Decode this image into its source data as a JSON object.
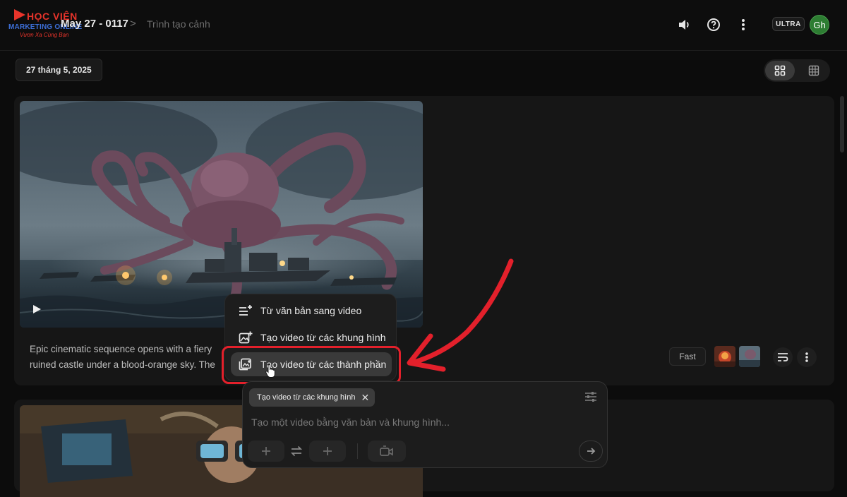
{
  "logo": {
    "line1": "HỌC VIỆN",
    "line2": "MARKETING ONLINE",
    "line3": "Vươn Xa Cùng Bạn"
  },
  "header": {
    "project_title": "May 27 - 0117",
    "separator": ">",
    "page_title": "Trình tạo cảnh",
    "plan_badge": "ULTRA",
    "avatar_initials": "Gh"
  },
  "toolbar": {
    "date_chip": "27 tháng 5, 2025"
  },
  "scene": {
    "prompt_line1": "Epic cinematic sequence opens with a fiery",
    "prompt_line2": "ruined castle under a blood-orange sky. The",
    "model_chip": "Fast"
  },
  "menu": {
    "items": [
      {
        "label": "Từ văn bản sang video",
        "icon": "text-lines-plus-icon"
      },
      {
        "label": "Tạo video từ các khung hình",
        "icon": "image-frames-icon"
      },
      {
        "label": "Tạo video từ các thành phần",
        "icon": "ingredients-icon"
      }
    ]
  },
  "composer": {
    "mode_chip": "Tạo video từ các khung hình",
    "placeholder": "Tạo một video bằng văn bản và khung hình..."
  },
  "colors": {
    "background": "#0c0c0c",
    "card": "#161616",
    "highlight_red": "#e3202b",
    "avatar_green": "#2d7d32"
  }
}
